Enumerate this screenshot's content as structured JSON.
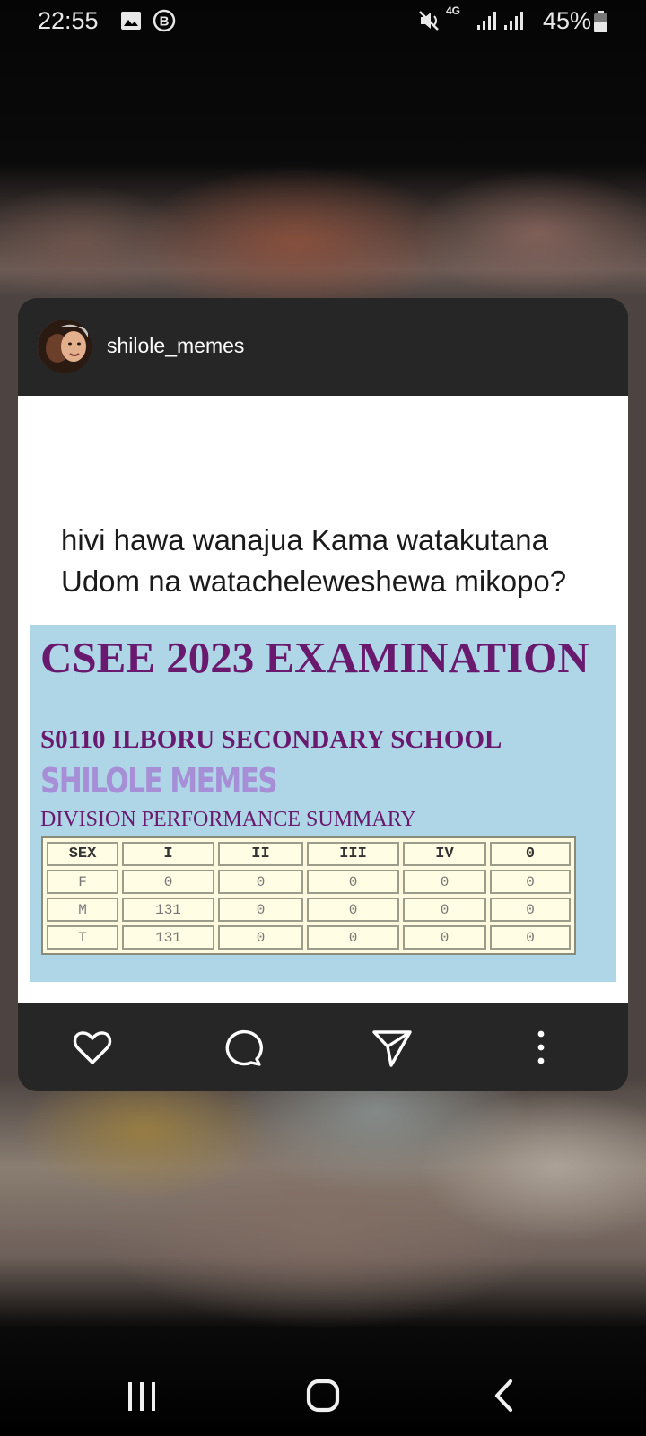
{
  "status_bar": {
    "time": "22:55",
    "network": "4G",
    "battery": "45%"
  },
  "post": {
    "username": "shilole_memes",
    "caption": "hivi hawa wanajua Kama watakutana Udom na watacheleweshewa mikopo?",
    "image": {
      "title": "CSEE 2023 EXAMINATION",
      "school": "S0110 ILBORU SECONDARY SCHOOL",
      "watermark": "SHILOLE MEMES",
      "subtitle": "DIVISION PERFORMANCE SUMMARY",
      "table": {
        "headers": [
          "SEX",
          "I",
          "II",
          "III",
          "IV",
          "0"
        ],
        "rows": [
          [
            "F",
            "0",
            "0",
            "0",
            "0",
            "0"
          ],
          [
            "M",
            "131",
            "0",
            "0",
            "0",
            "0"
          ],
          [
            "T",
            "131",
            "0",
            "0",
            "0",
            "0"
          ]
        ]
      }
    },
    "actions": {
      "like_icon": "heart-icon",
      "comment_icon": "speech-bubble-icon",
      "share_icon": "paper-plane-icon",
      "more_icon": "vertical-dots-icon"
    }
  },
  "nav_bar": {
    "recents_icon": "recents-icon",
    "home_icon": "home-icon",
    "back_icon": "back-icon"
  },
  "colors": {
    "card_bg": "#262626",
    "image_bg": "#aed6e6",
    "title_purple": "#6a1a6e",
    "watermark_lavender": "#a78fd8"
  }
}
